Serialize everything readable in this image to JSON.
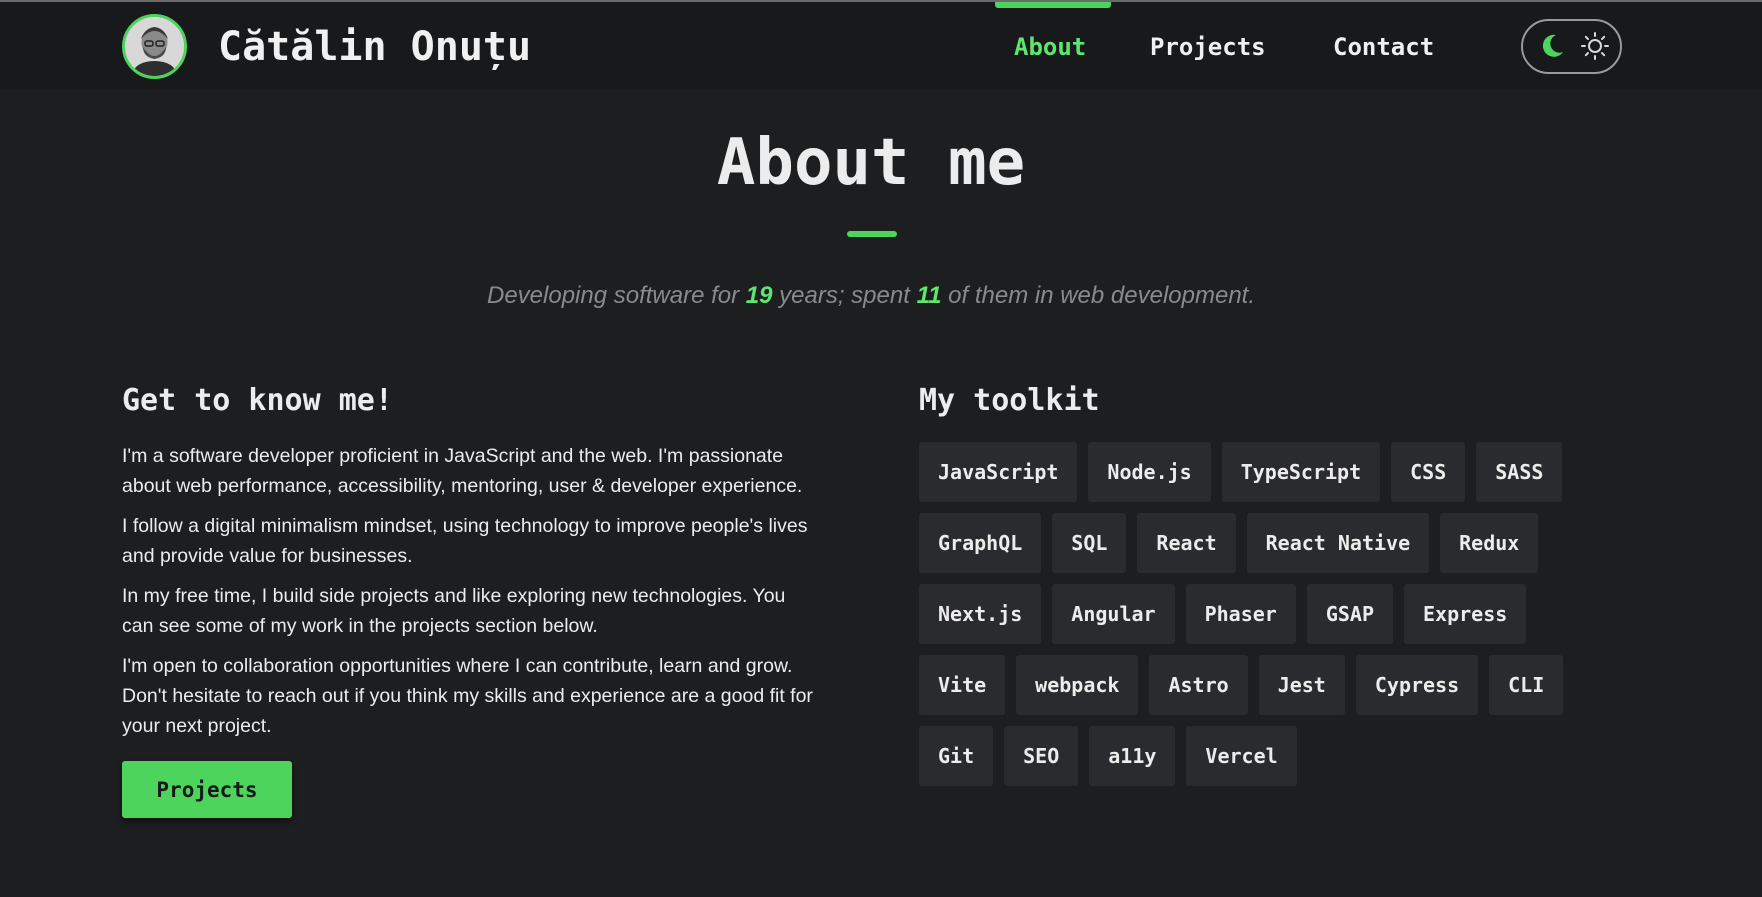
{
  "header": {
    "name": "Cătălin Onuțu",
    "nav": [
      {
        "label": "About",
        "active": true
      },
      {
        "label": "Projects",
        "active": false
      },
      {
        "label": "Contact",
        "active": false
      }
    ],
    "theme_toggle": {
      "icons": [
        "moon-icon",
        "sun-icon"
      ]
    }
  },
  "about": {
    "title": "About me",
    "subtitle": {
      "part1": "Developing software for ",
      "years_total": "19",
      "part2": " years; spent ",
      "years_web": "11",
      "part3": " of them in web development."
    }
  },
  "know_me": {
    "heading": "Get to know me!",
    "paragraphs": [
      "I'm a software developer proficient in JavaScript and the web. I'm passionate about web performance, accessibility, mentoring, user & developer experience.",
      "I follow a digital minimalism mindset, using technology to improve people's lives and provide value for businesses.",
      "In my free time, I build side projects and like exploring new technologies. You can see some of my work in the projects section below.",
      "I'm open to collaboration opportunities where I can contribute, learn and grow. Don't hesitate to reach out if you think my skills and experience are a good fit for your next project."
    ],
    "button_label": "Projects"
  },
  "toolkit": {
    "heading": "My toolkit",
    "rows": [
      [
        "JavaScript",
        "Node.js",
        "TypeScript",
        "CSS",
        "SASS"
      ],
      [
        "GraphQL",
        "SQL",
        "React",
        "React Native",
        "Redux"
      ],
      [
        "Next.js",
        "Angular",
        "Phaser",
        "GSAP",
        "Express"
      ],
      [
        "Vite",
        "webpack",
        "Astro",
        "Jest",
        "Cypress",
        "CLI"
      ],
      [
        "Git",
        "SEO",
        "a11y",
        "Vercel"
      ]
    ]
  },
  "colors": {
    "accent": "#4cd45c",
    "background": "#1d1e20",
    "header": "#18191b",
    "tag": "#2a2b2e"
  }
}
